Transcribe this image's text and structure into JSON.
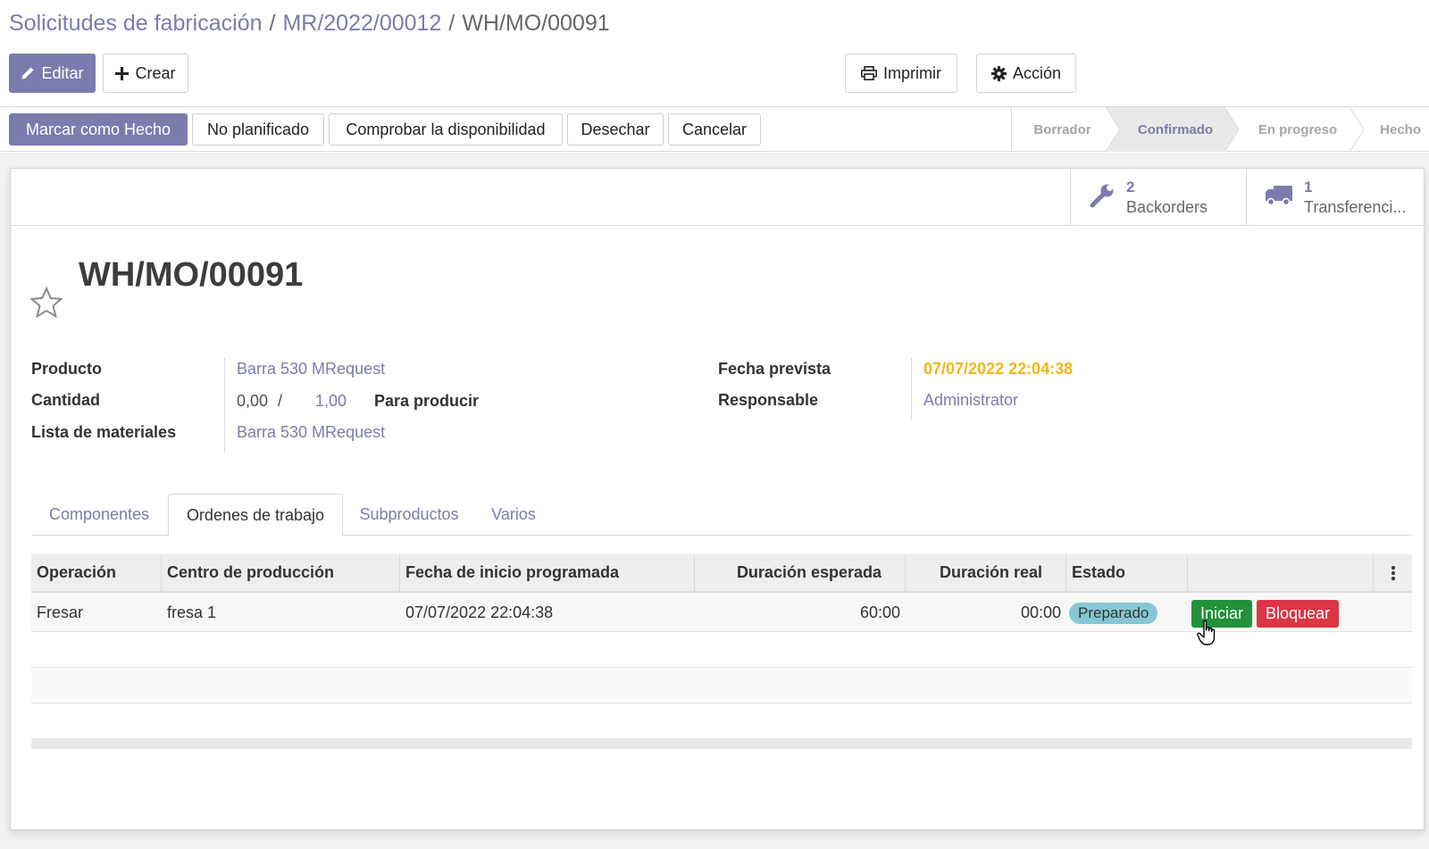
{
  "breadcrumb": {
    "items": [
      "Solicitudes de fabricación",
      "MR/2022/00012"
    ],
    "separator": "/",
    "current": "WH/MO/00091"
  },
  "toolbar": {
    "edit_label": "Editar",
    "create_label": "Crear",
    "print_label": "Imprimir",
    "action_label": "Acción"
  },
  "statusbar": {
    "buttons": {
      "mark_done": "Marcar como Hecho",
      "unplanned": "No planificado",
      "check_availability": "Comprobar la disponibilidad",
      "scrap": "Desechar",
      "cancel": "Cancelar"
    },
    "stages": [
      "Borrador",
      "Confirmado",
      "En progreso",
      "Hecho"
    ],
    "active_stage": "Confirmado"
  },
  "smart_buttons": {
    "backorders": {
      "count": "2",
      "label": "Backorders"
    },
    "transfers": {
      "count": "1",
      "label": "Transferenci..."
    }
  },
  "record": {
    "title": "WH/MO/00091",
    "favorite": false
  },
  "fields": {
    "product": {
      "label": "Producto",
      "value": "Barra 530 MRequest"
    },
    "quantity": {
      "label": "Cantidad",
      "produced": "0,00",
      "separator": "/",
      "planned": "1,00",
      "suffix": "Para producir"
    },
    "bom": {
      "label": "Lista de materiales",
      "value": "Barra 530 MRequest"
    },
    "date_planned": {
      "label": "Fecha prevista",
      "value": "07/07/2022 22:04:38"
    },
    "responsible": {
      "label": "Responsable",
      "value": "Administrator"
    }
  },
  "tabs": [
    "Componentes",
    "Ordenes de trabajo",
    "Subproductos",
    "Varios"
  ],
  "active_tab": "Ordenes de trabajo",
  "workorders": {
    "columns": [
      "Operación",
      "Centro de producción",
      "Fecha de inicio programada",
      "Duración esperada",
      "Duración real",
      "Estado"
    ],
    "rows": [
      {
        "operation": "Fresar",
        "workcenter": "fresa 1",
        "date_start": "07/07/2022 22:04:38",
        "duration_expected": "60:00",
        "duration": "00:00",
        "state": "Preparado",
        "start_label": "Iniciar",
        "block_label": "Bloquear"
      }
    ]
  },
  "colors": {
    "brand": "#7c7bad",
    "warning": "#f0b719",
    "success": "#21913b",
    "danger": "#dc3545",
    "badge_ready": "#85c8d3"
  },
  "icons": {
    "edit": "pencil-icon",
    "create": "plus-icon",
    "print": "printer-icon",
    "action": "gear-icon",
    "backorders": "wrench-icon",
    "transfers": "truck-icon",
    "favorite": "star-icon",
    "optional_columns": "kebab-icon"
  }
}
